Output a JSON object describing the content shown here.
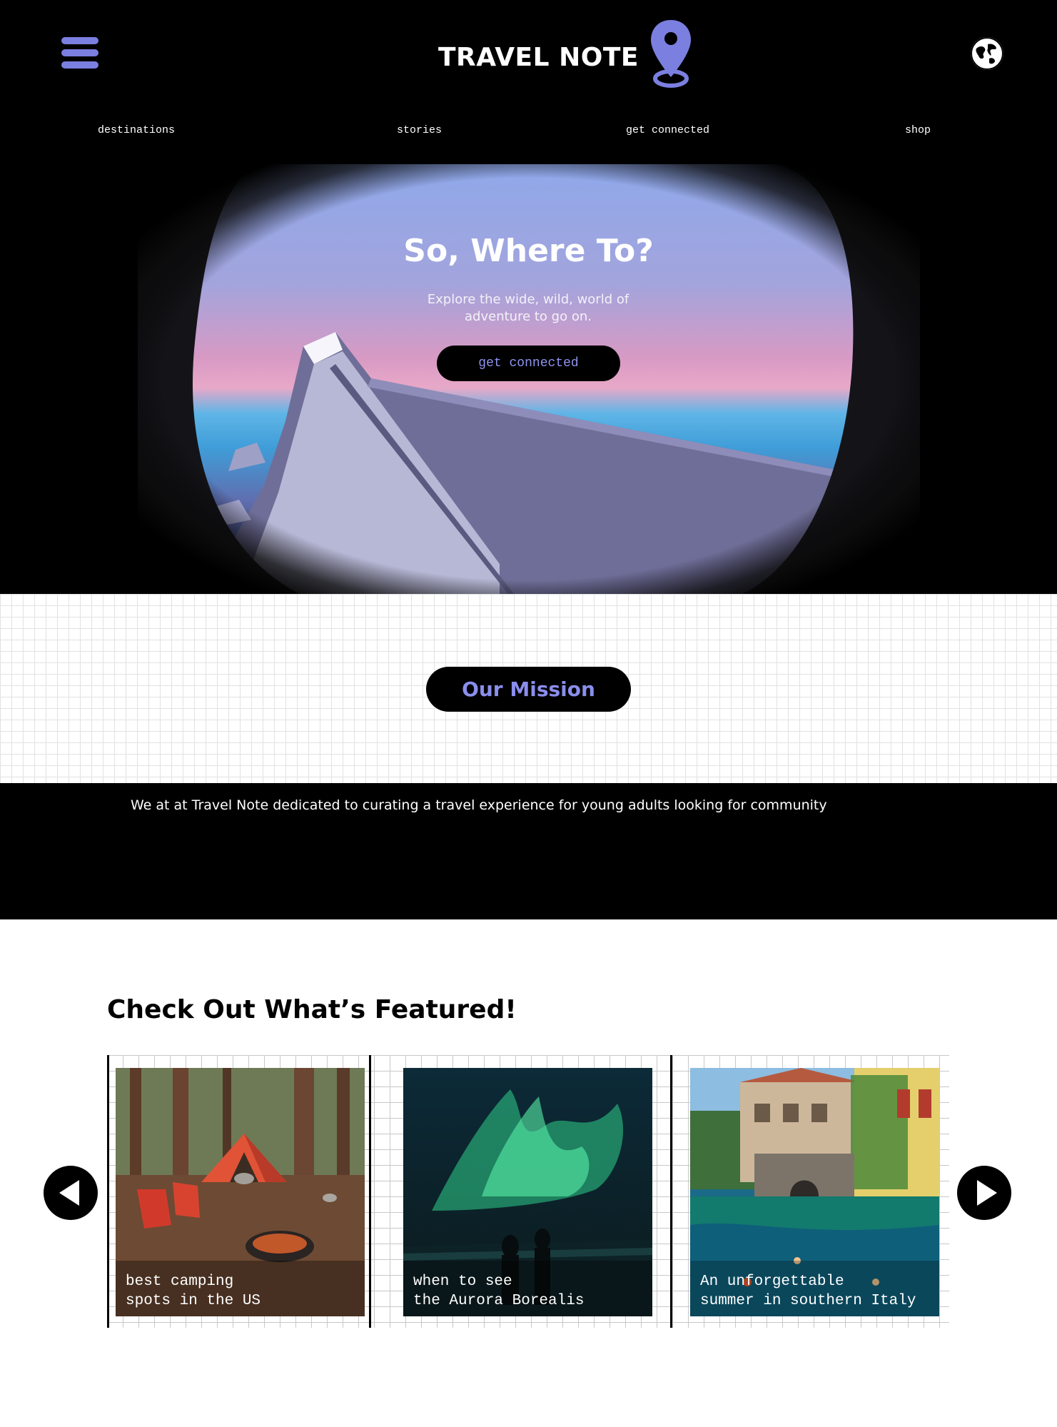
{
  "brand": {
    "name": "TRAVEL NOTE",
    "accent": "#7b7fe0"
  },
  "header": {
    "menu_icon": "hamburger-menu-icon",
    "profile_icon": "globe-map-icon"
  },
  "nav": {
    "items": [
      {
        "label": "destinations"
      },
      {
        "label": "stories"
      },
      {
        "label": "get connected"
      },
      {
        "label": "shop"
      }
    ]
  },
  "hero": {
    "title": "So, Where To?",
    "subtitle": "Explore the wide, wild, world of adventure to go on.",
    "button_label": "get connected",
    "image": "airplane-window-wing-view"
  },
  "mission": {
    "button_label": "Our Mission",
    "text": "We at at Travel Note dedicated to curating a travel experience for young adults looking for community"
  },
  "featured": {
    "title": "Check Out What’s Featured!",
    "prev_icon": "arrow-left-icon",
    "next_icon": "arrow-right-icon",
    "cards": [
      {
        "caption": "best camping\nspots in the US",
        "image": "campsite-tent-forest"
      },
      {
        "caption": "when to see\nthe Aurora Borealis",
        "image": "aurora-borealis-couple"
      },
      {
        "caption": "An unforgettable\nsummer in southern Italy",
        "image": "italian-lake-village"
      }
    ]
  }
}
